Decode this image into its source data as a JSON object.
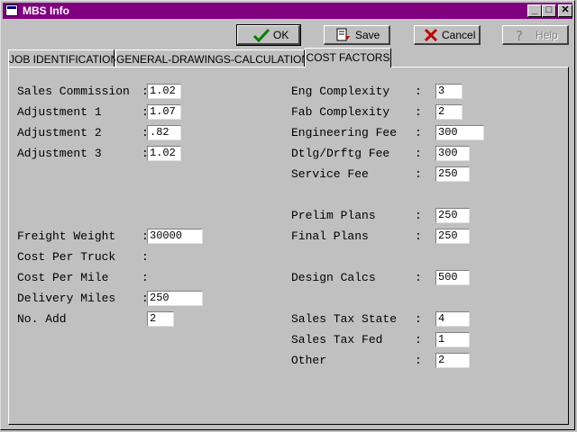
{
  "window": {
    "title": "MBS Info"
  },
  "toolbar": {
    "ok_label": "OK",
    "save_label": "Save",
    "cancel_label": "Cancel",
    "help_label": "Help"
  },
  "tabs": [
    {
      "label": "JOB IDENTIFICATION"
    },
    {
      "label": "GENERAL-DRAWINGS-CALCULATIONS"
    },
    {
      "label": "COST FACTORS"
    }
  ],
  "left_fields": [
    {
      "label": "Sales Commission",
      "value": "1.02"
    },
    {
      "label": "Adjustment 1",
      "value": "1.07"
    },
    {
      "label": "Adjustment 2",
      "value": ".82"
    },
    {
      "label": "Adjustment 3",
      "value": "1.02"
    },
    {
      "label": "Freight Weight",
      "value": "30000"
    },
    {
      "label": "Cost Per Truck",
      "value": ""
    },
    {
      "label": "Cost Per Mile",
      "value": ""
    },
    {
      "label": "Delivery Miles",
      "value": "250"
    },
    {
      "label": "No. Add",
      "value": "2"
    }
  ],
  "right_fields": [
    {
      "label": "Eng Complexity",
      "value": "3"
    },
    {
      "label": "Fab Complexity",
      "value": "2"
    },
    {
      "label": "Engineering Fee",
      "value": "300"
    },
    {
      "label": "Dtlg/Drftg Fee",
      "value": "300"
    },
    {
      "label": "Service Fee",
      "value": "250"
    },
    {
      "label": "Prelim Plans",
      "value": "250"
    },
    {
      "label": "Final Plans",
      "value": "250"
    },
    {
      "label": "Design Calcs",
      "value": "500"
    },
    {
      "label": "Sales Tax State",
      "value": "4"
    },
    {
      "label": "Sales Tax Fed",
      "value": "1"
    },
    {
      "label": "Other",
      "value": "2"
    }
  ],
  "colors": {
    "titlebar": "#800080",
    "face": "#c0c0c0",
    "ok_check": "#008000",
    "cancel_x": "#c00000"
  }
}
